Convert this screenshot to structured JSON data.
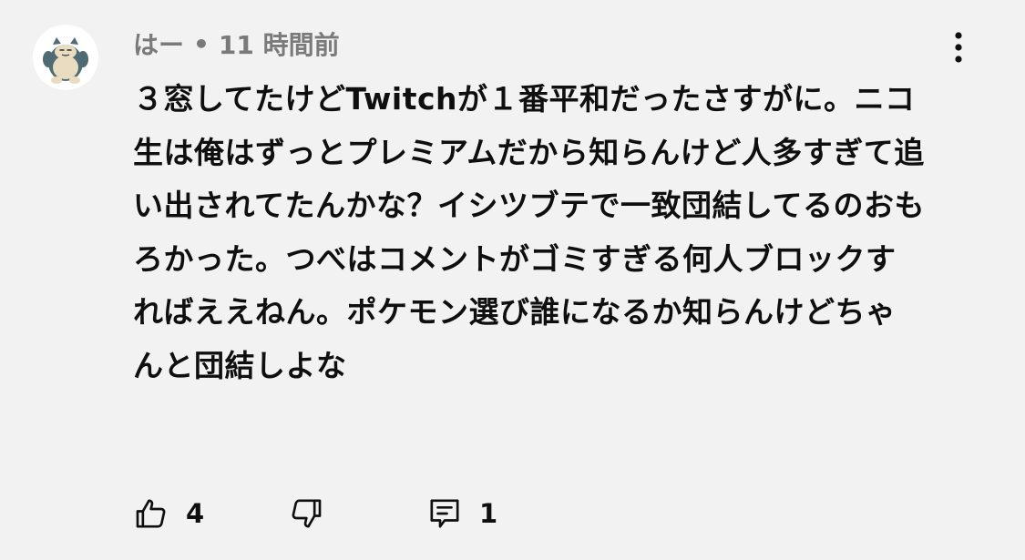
{
  "comment": {
    "author": "はー",
    "separator": "•",
    "time": "11 時間前",
    "text": "３窓してたけどTwitchが１番平和だったさすがに。ニコ生は俺はずっとプレミアムだから知らんけど人多すぎて追い出されてたんかな？イシツブテで一致団結してるのおもろかった。つべはコメントがゴミすぎる何人ブロックすればええねん。ポケモン選び誰になるか知らんけどちゃんと団結しよな",
    "avatar_icon": "snorlax-avatar",
    "more_icon": "more-vertical-icon"
  },
  "actions": {
    "like_count": "4",
    "reply_count": "1",
    "like_icon": "thumbs-up-icon",
    "dislike_icon": "thumbs-down-icon",
    "reply_icon": "comment-reply-icon"
  }
}
